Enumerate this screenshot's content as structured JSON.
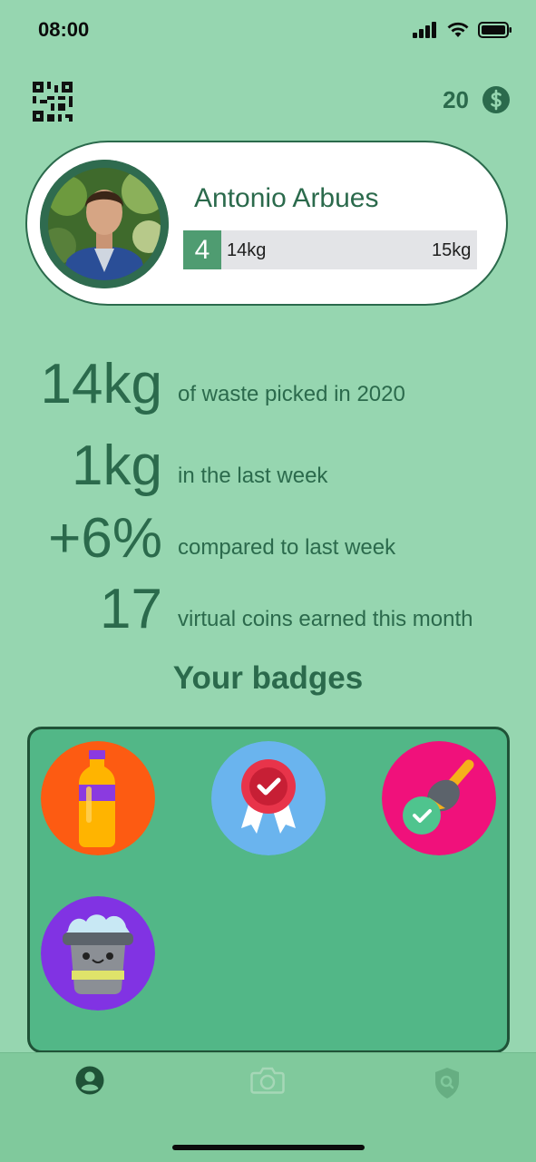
{
  "status_bar": {
    "time": "08:00"
  },
  "header": {
    "coins": "20"
  },
  "profile": {
    "name": "Antonio Arbues",
    "level": "4",
    "current_weight": "14kg",
    "target_weight": "15kg",
    "progress_fraction": 0.93
  },
  "stats": [
    {
      "value": "14kg",
      "label": "of waste picked in 2020"
    },
    {
      "value": "1kg",
      "label": "in the last week"
    },
    {
      "value": "+6%",
      "label": "compared to last week"
    },
    {
      "value": "17",
      "label": "virtual coins earned this month"
    }
  ],
  "badges": {
    "title": "Your badges",
    "items": [
      {
        "icon": "bottle-badge-icon",
        "color": "#fd5b12"
      },
      {
        "icon": "ribbon-award-badge-icon",
        "color": "#6ab4ee"
      },
      {
        "icon": "paint-brush-badge-icon",
        "color": "#f0117b"
      },
      {
        "icon": "trash-bin-badge-icon",
        "color": "#8133e3"
      }
    ]
  },
  "tabbar": {
    "items": [
      {
        "icon": "profile-icon",
        "active": true
      },
      {
        "icon": "camera-icon",
        "active": false
      },
      {
        "icon": "shield-search-icon",
        "active": false
      }
    ]
  },
  "colors": {
    "background": "#96d6b0",
    "accent": "#2b6a4c",
    "panel": "#52b787"
  }
}
